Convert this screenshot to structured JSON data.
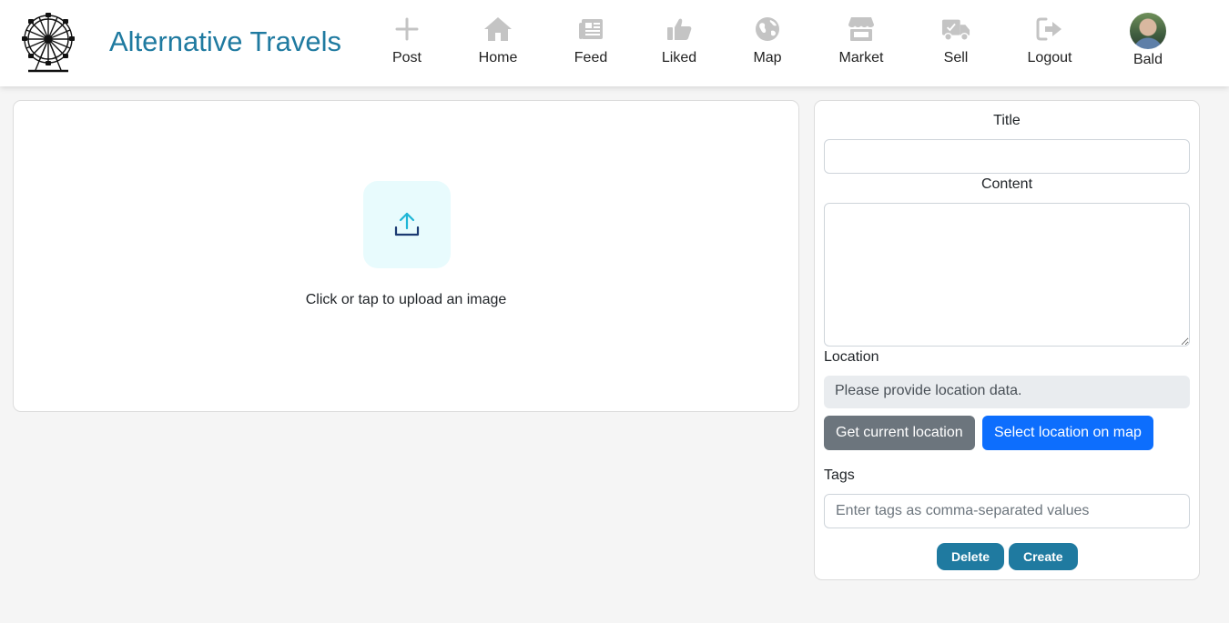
{
  "header": {
    "brand": "Alternative Travels",
    "nav": [
      {
        "label": "Post",
        "icon": "plus-icon"
      },
      {
        "label": "Home",
        "icon": "home-icon"
      },
      {
        "label": "Feed",
        "icon": "newspaper-icon"
      },
      {
        "label": "Liked",
        "icon": "thumbs-up-icon"
      },
      {
        "label": "Map",
        "icon": "globe-icon"
      },
      {
        "label": "Market",
        "icon": "store-icon"
      },
      {
        "label": "Sell",
        "icon": "truck-icon"
      },
      {
        "label": "Logout",
        "icon": "logout-icon"
      },
      {
        "label": "Bald",
        "icon": "avatar"
      }
    ]
  },
  "upload": {
    "icon": "upload-icon",
    "text": "Click or tap to upload an image"
  },
  "form": {
    "title_label": "Title",
    "title_value": "",
    "content_label": "Content",
    "content_value": "",
    "location_label": "Location",
    "location_value": "Please provide location data.",
    "get_location_button": "Get current location",
    "select_location_button": "Select location on map",
    "tags_label": "Tags",
    "tags_placeholder": "Enter tags as comma-separated values",
    "delete_button": "Delete",
    "create_button": "Create"
  },
  "colors": {
    "brand": "#1f7aa0",
    "nav_icon": "#c4c4c4",
    "upload_bg": "#e8fbfd",
    "upload_arrow": "#1fb6d6",
    "primary_blue": "#0d6efd",
    "secondary_gray": "#6c757d"
  }
}
